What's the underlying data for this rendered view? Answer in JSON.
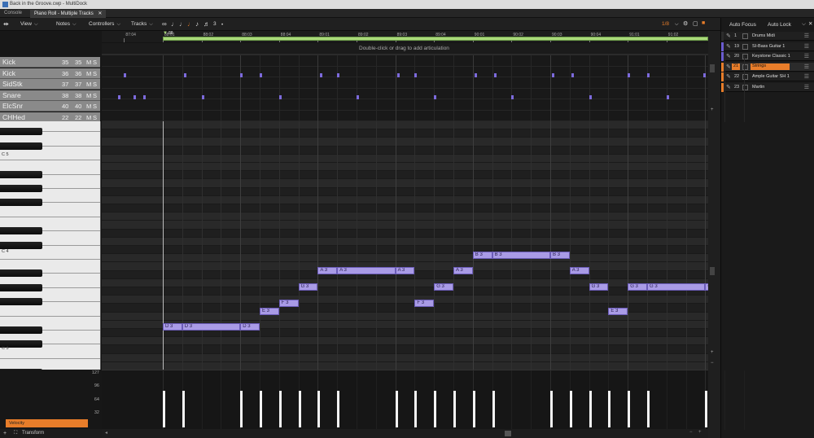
{
  "window": {
    "title": "Back in the Groove.cwp - MultiDock"
  },
  "tabs": [
    {
      "label": "Console"
    },
    {
      "label": "Piano Roll - Multiple Tracks"
    }
  ],
  "menu": {
    "view": "View",
    "notes": "Notes",
    "controllers": "Controllers",
    "tracks": "Tracks",
    "snap_value": "1/8",
    "triplet": "3"
  },
  "right_panel": {
    "auto_focus": "Auto Focus",
    "auto_lock": "Auto Lock",
    "tracks": [
      {
        "num": "1",
        "name": "Drums Midi",
        "color": "#2c2c2c"
      },
      {
        "num": "19",
        "name": "SI-Bass Guitar 1",
        "color": "#6b5cd0"
      },
      {
        "num": "20",
        "name": "Keystone Classic 1",
        "color": "#6b5cd0"
      },
      {
        "num": "21",
        "name": "Strings",
        "color": "#e87d2a",
        "selected": true
      },
      {
        "num": "22",
        "name": "Ample Guitar SH 1",
        "color": "#e87d2a"
      },
      {
        "num": "23",
        "name": "Martin",
        "color": "#e87d2a"
      }
    ]
  },
  "timeline": {
    "ticks": [
      "87:04",
      "88:01",
      "88:02",
      "88:03",
      "88:04",
      "89:01",
      "89:02",
      "89:03",
      "89:04",
      "90:01",
      "90:02",
      "90:03",
      "90:04",
      "91:01",
      "91:02"
    ],
    "now_marker": "88"
  },
  "articulation_hint": "Double-click or drag to add articulation",
  "drum_map": [
    {
      "name": "Kick",
      "in": "35",
      "out": "35",
      "m": "M",
      "s": "S"
    },
    {
      "name": "Kick",
      "in": "36",
      "out": "36",
      "m": "M",
      "s": "S"
    },
    {
      "name": "SidStk",
      "in": "37",
      "out": "37",
      "m": "M",
      "s": "S"
    },
    {
      "name": "Snare",
      "in": "38",
      "out": "38",
      "m": "M",
      "s": "S"
    },
    {
      "name": "ElcSnr",
      "in": "40",
      "out": "40",
      "m": "M",
      "s": "S"
    },
    {
      "name": "CHHed",
      "in": "22",
      "out": "22",
      "m": "M",
      "s": "S"
    }
  ],
  "keyboard": {
    "c_labels": [
      "C 5",
      "C 4",
      "C 3"
    ]
  },
  "notes": [
    {
      "pitch": "D 3",
      "beat": 0,
      "len": 1
    },
    {
      "pitch": "D 3",
      "beat": 1,
      "len": 3
    },
    {
      "pitch": "D 3",
      "beat": 4,
      "len": 1
    },
    {
      "pitch": "E 3",
      "beat": 5,
      "len": 1
    },
    {
      "pitch": "F 3",
      "beat": 6,
      "len": 1
    },
    {
      "pitch": "G 3",
      "beat": 7,
      "len": 1
    },
    {
      "pitch": "A 3",
      "beat": 8,
      "len": 1
    },
    {
      "pitch": "A 3",
      "beat": 9,
      "len": 3
    },
    {
      "pitch": "A 3",
      "beat": 12,
      "len": 1
    },
    {
      "pitch": "F 3",
      "beat": 13,
      "len": 1
    },
    {
      "pitch": "G 3",
      "beat": 14,
      "len": 1
    },
    {
      "pitch": "A 3",
      "beat": 15,
      "len": 1
    },
    {
      "pitch": "B 3",
      "beat": 16,
      "len": 1
    },
    {
      "pitch": "B 3",
      "beat": 17,
      "len": 3
    },
    {
      "pitch": "B 3",
      "beat": 20,
      "len": 1
    },
    {
      "pitch": "A 3",
      "beat": 21,
      "len": 1
    },
    {
      "pitch": "G 3",
      "beat": 22,
      "len": 1
    },
    {
      "pitch": "E 3",
      "beat": 23,
      "len": 1
    },
    {
      "pitch": "G 3",
      "beat": 24,
      "len": 1
    },
    {
      "pitch": "G 3",
      "beat": 25,
      "len": 3
    },
    {
      "pitch": "G 3",
      "beat": 28,
      "len": 0.2
    }
  ],
  "velocity": {
    "label": "Velocity",
    "scale": [
      "127",
      "96",
      "64",
      "32"
    ],
    "value": 96
  },
  "transform_label": "Transform"
}
